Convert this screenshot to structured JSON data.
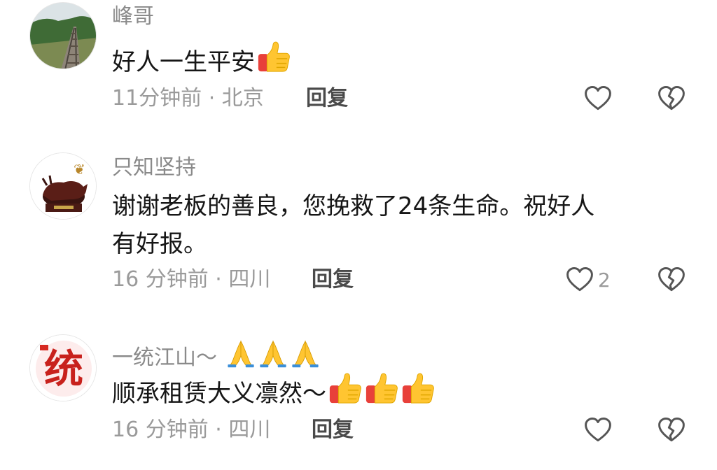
{
  "comments": [
    {
      "username": "峰哥",
      "text": "好人一生平安",
      "text_line2": "",
      "meta": "11分钟前 · 北京",
      "reply_label": "回复",
      "like_count": ""
    },
    {
      "username": "只知坚持",
      "text": "谢谢老板的善良，您挽救了24条生命。祝好人",
      "text_line2": "有好报。",
      "meta": "16 分钟前 · 四川",
      "reply_label": "回复",
      "like_count": "2"
    },
    {
      "username": "一统江山～",
      "text": "顺承租赁大义凛然～",
      "text_line2": "",
      "meta": "16 分钟前 · 四川",
      "reply_label": "回复",
      "like_count": ""
    }
  ],
  "colors": {
    "username": "#8a8a8a",
    "text": "#161616",
    "meta": "#9a9a9a",
    "reply": "#4a4a4a",
    "icon": "#555555"
  },
  "icons": [
    "heart-outline-icon",
    "broken-heart-icon",
    "thumbs-up-emoji",
    "praying-hands-emoji"
  ]
}
